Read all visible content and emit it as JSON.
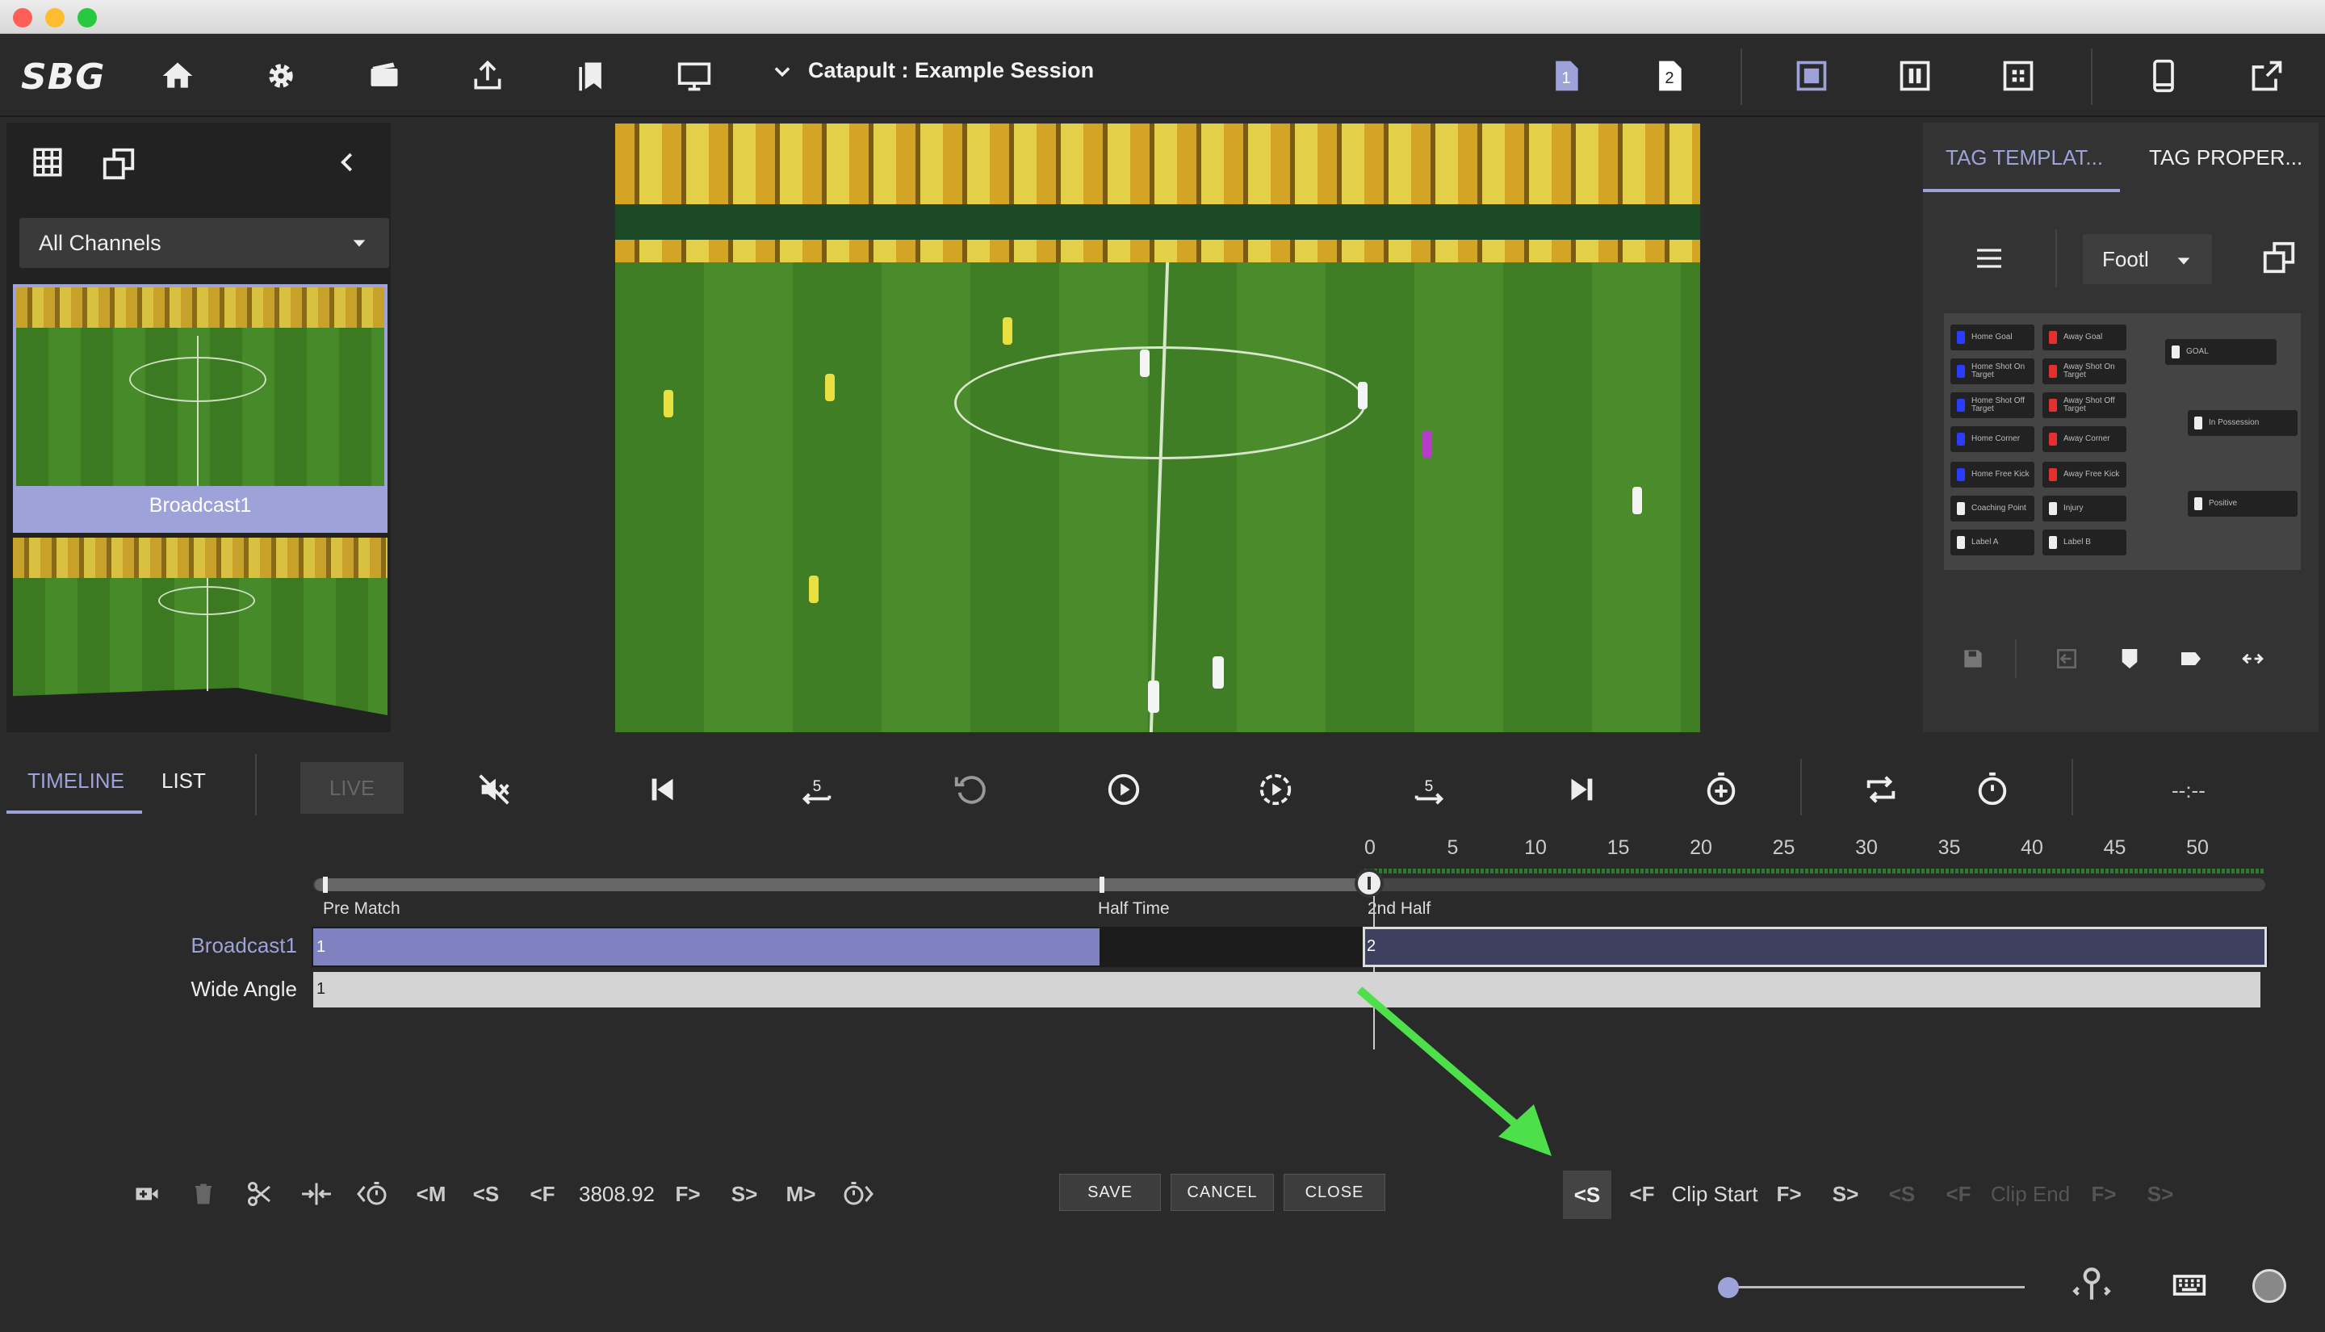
{
  "app": {
    "logo": "SBG",
    "session_title": "Catapult : Example Session",
    "clips_badges": [
      "1",
      "2"
    ]
  },
  "left": {
    "channel_select": "All Channels",
    "thumbnails": [
      {
        "label": "Broadcast1"
      },
      {
        "label": ""
      }
    ]
  },
  "right": {
    "tabs": [
      "TAG TEMPLAT...",
      "TAG PROPER..."
    ],
    "template_select": "Footl",
    "tags_col1": [
      "Home Goal",
      "Home Shot On Target",
      "Home Shot Off Target",
      "Home Corner",
      "Home Free Kick",
      "Coaching Point",
      "Label A"
    ],
    "tags_col2": [
      "Away Goal",
      "Away Shot On Target",
      "Away Shot Off Target",
      "Away Corner",
      "Away Free Kick",
      "Injury",
      "Label B"
    ],
    "tags_col3": [
      "GOAL",
      "In Possession",
      "Positive"
    ],
    "colors": {
      "home": "#2a3cff",
      "away": "#e53030"
    }
  },
  "timeline": {
    "tabs": [
      "TIMELINE",
      "LIST"
    ],
    "live_label": "LIVE",
    "clock": "--:--",
    "ruler": [
      "0",
      "5",
      "10",
      "15",
      "20",
      "25",
      "30",
      "35",
      "40",
      "45",
      "50"
    ],
    "periods": [
      "Pre Match",
      "Half Time",
      "2nd Half"
    ],
    "tracks": [
      {
        "name": "Broadcast1",
        "segments": [
          "1",
          "2"
        ]
      },
      {
        "name": "Wide Angle",
        "segments": [
          "1"
        ]
      }
    ],
    "time_value": "3808.92",
    "nav": {
      "m_back": "<M",
      "s_back": "<S",
      "f_back": "<F",
      "f_fwd": "F>",
      "s_fwd": "S>",
      "m_fwd": "M>"
    },
    "buttons": {
      "save": "SAVE",
      "cancel": "CANCEL",
      "close": "CLOSE"
    },
    "clip": {
      "start_label": "Clip Start",
      "end_label": "Clip End",
      "s_back": "<S",
      "f_back": "<F",
      "f_fwd": "F>",
      "s_fwd": "S>"
    }
  },
  "colors": {
    "accent": "#9da2d8",
    "track_active": "#7f82c0",
    "track_dark": "#3e4060",
    "arrow": "#4ee04a"
  }
}
